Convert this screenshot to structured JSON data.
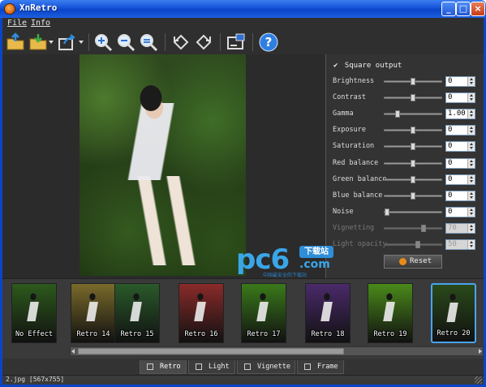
{
  "window": {
    "title": "XnRetro"
  },
  "menu": {
    "items": [
      "File",
      "Info"
    ]
  },
  "toolbar": {
    "buttons": [
      "open-icon",
      "save-icon",
      "share-icon",
      "zoom-in-icon",
      "zoom-out-icon",
      "zoom-fit-icon",
      "rotate-left-icon",
      "rotate-right-icon",
      "screen-icon",
      "help-icon"
    ]
  },
  "panel": {
    "square_output": "Square output",
    "rows": [
      {
        "label": "Brightness",
        "value": "0",
        "level": 0.5,
        "enabled": true
      },
      {
        "label": "Contrast",
        "value": "0",
        "level": 0.5,
        "enabled": true
      },
      {
        "label": "Gamma",
        "value": "1.00",
        "level": 0.2,
        "enabled": true
      },
      {
        "label": "Exposure",
        "value": "0",
        "level": 0.5,
        "enabled": true
      },
      {
        "label": "Saturation",
        "value": "0",
        "level": 0.5,
        "enabled": true
      },
      {
        "label": "Red balance",
        "value": "0",
        "level": 0.5,
        "enabled": true
      },
      {
        "label": "Green balance",
        "value": "0",
        "level": 0.5,
        "enabled": true
      },
      {
        "label": "Blue balance",
        "value": "0",
        "level": 0.5,
        "enabled": true
      },
      {
        "label": "Noise",
        "value": "0",
        "level": 0.0,
        "enabled": true
      },
      {
        "label": "Vignetting",
        "value": "70",
        "level": 0.7,
        "enabled": false
      },
      {
        "label": "Light opacity",
        "value": "50",
        "level": 0.6,
        "enabled": false
      }
    ],
    "reset_label": "Reset"
  },
  "watermark": {
    "brand": "pc6",
    "download": "下载站",
    "domain": ".com",
    "tagline": "中国最安全的下载站"
  },
  "thumbnails": [
    {
      "label": "No Effect",
      "selected": false,
      "tint": "#2d5a1c"
    },
    {
      "label": "Retro 14",
      "selected": false,
      "tint": "#7a6a2a"
    },
    {
      "label": "Retro 15",
      "selected": false,
      "tint": "#2a5a2a"
    },
    {
      "label": "Retro 16",
      "selected": false,
      "tint": "#8a2a2a"
    },
    {
      "label": "Retro 17",
      "selected": false,
      "tint": "#3a7a1a"
    },
    {
      "label": "Retro 18",
      "selected": false,
      "tint": "#4a2a6a"
    },
    {
      "label": "Retro 19",
      "selected": false,
      "tint": "#4a8a1a"
    },
    {
      "label": "Retro 20",
      "selected": true,
      "tint": "#2a4a1a"
    }
  ],
  "tabs": [
    {
      "label": "Retro",
      "active": true
    },
    {
      "label": "Light",
      "active": false
    },
    {
      "label": "Vignette",
      "active": false
    },
    {
      "label": "Frame",
      "active": false
    }
  ],
  "status": {
    "text": "2.jpg [567x755]"
  },
  "colors": {
    "accent": "#4aa3f0",
    "title_bar": "#0a45c9",
    "watermark": "#3aa6e8"
  }
}
